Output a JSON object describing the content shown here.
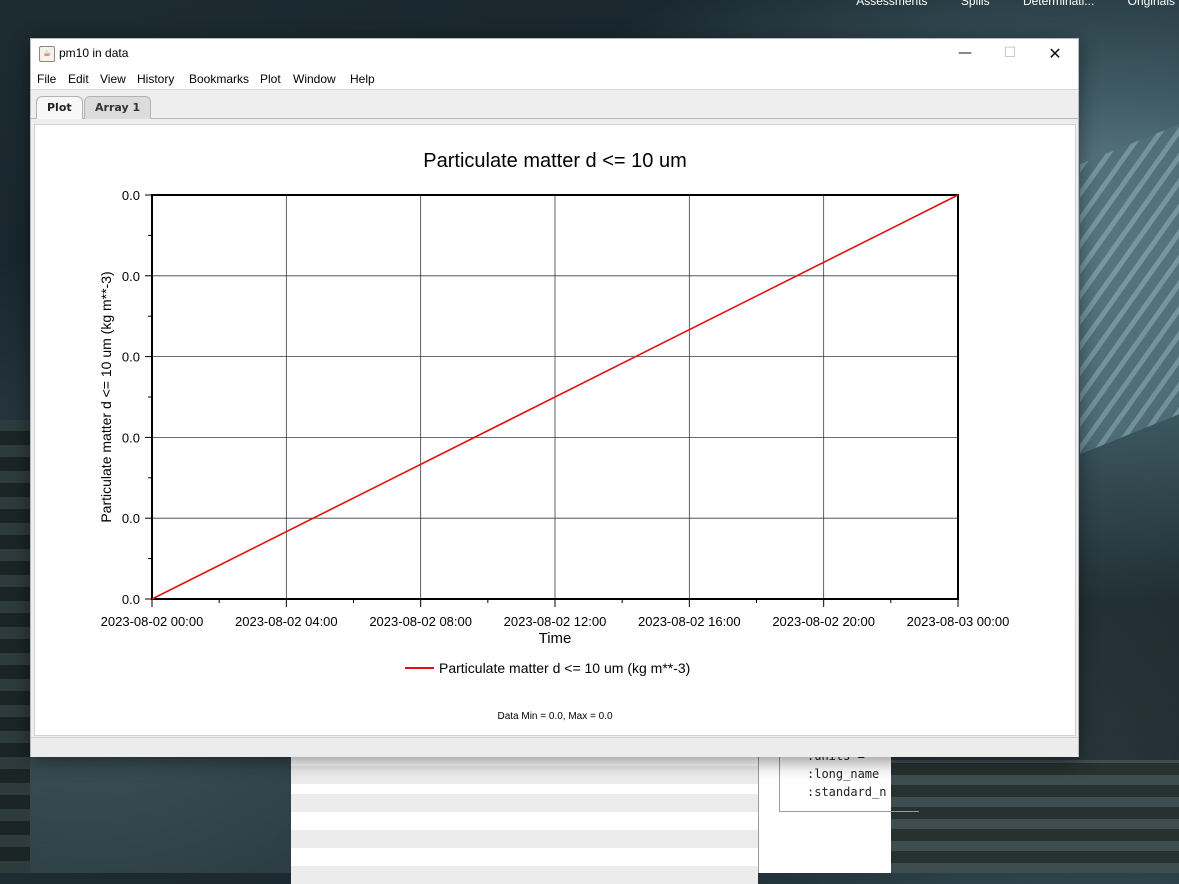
{
  "background": {
    "top_tabs": [
      "Assessments",
      "Spills",
      "Determinati...",
      "Originals"
    ],
    "attrs_lines": [
      ":units = \"",
      ":long_name",
      ":standard_n"
    ]
  },
  "window": {
    "title": "pm10 in data",
    "icon": "java-cup-icon",
    "controls": {
      "minimize": "—",
      "maximize": "☐",
      "close": "✕"
    }
  },
  "menu": [
    "File",
    "Edit",
    "View",
    "History",
    "Bookmarks",
    "Plot",
    "Window",
    "Help"
  ],
  "tabs": {
    "active": "Plot",
    "inactive": "Array 1"
  },
  "chart_data": {
    "type": "line",
    "title": "Particulate matter d <= 10 um",
    "xlabel": "Time",
    "ylabel": "Particulate matter d <= 10 um (kg m**-3)",
    "x_ticks": [
      "2023-08-02 00:00",
      "2023-08-02 04:00",
      "2023-08-02 08:00",
      "2023-08-02 12:00",
      "2023-08-02 16:00",
      "2023-08-02 20:00",
      "2023-08-03 00:00"
    ],
    "y_ticks": [
      "0.0",
      "0.0",
      "0.0",
      "0.0",
      "0.0",
      "0.0"
    ],
    "x": [
      "2023-08-02 00:00",
      "2023-08-03 00:00"
    ],
    "series": [
      {
        "name": "Particulate matter d <= 10 um (kg m**-3)",
        "values": [
          0.0,
          0.0
        ],
        "color": "#e01010"
      }
    ],
    "grid": true,
    "legend": "bottom-center",
    "footer": "Data Min = 0.0, Max = 0.0"
  }
}
